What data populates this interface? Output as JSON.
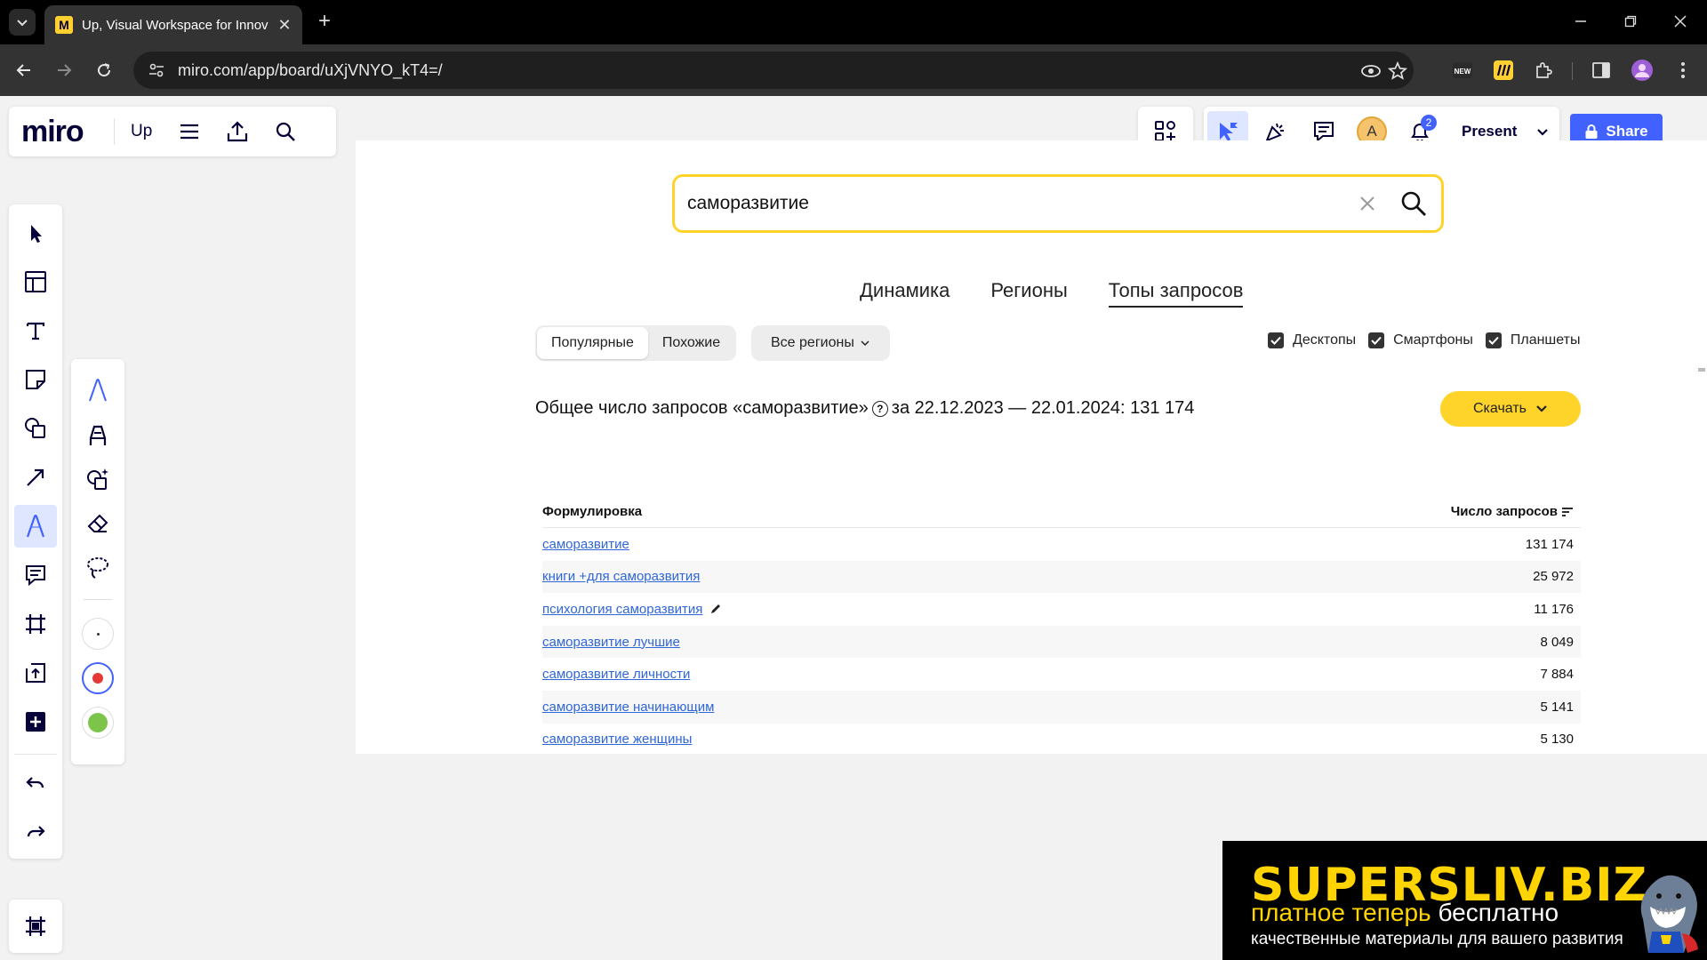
{
  "browser": {
    "tab_title": "Up, Visual Workspace for Innov",
    "url": "miro.com/app/board/uXjVNYO_kT4=/",
    "new_tab": "+",
    "close_tab": "✕"
  },
  "miro": {
    "logo": "miro",
    "board_name": "Up",
    "avatar_initial": "A",
    "notifications_count": "2",
    "present_label": "Present",
    "share_label": "Share",
    "accent": "#4262ff"
  },
  "wordstat": {
    "search_value": "саморазвитие",
    "tabs": [
      "Динамика",
      "Регионы",
      "Топы запросов"
    ],
    "segments": [
      "Популярные",
      "Похожие"
    ],
    "region": "Все регионы",
    "devices": [
      "Десктопы",
      "Смартфоны",
      "Планшеты"
    ],
    "total_text": "Общее число запросов «саморазвитие»",
    "total_period": "за 22.12.2023 — 22.01.2024: 131 174",
    "download_label": "Скачать",
    "table": {
      "col_phrase": "Формулировка",
      "col_count": "Число запросов",
      "rows": [
        {
          "phrase": "саморазвитие",
          "count": "131 174"
        },
        {
          "phrase": "книги +для саморазвития",
          "count": "25 972"
        },
        {
          "phrase": "психология саморазвития",
          "count": "11 176"
        },
        {
          "phrase": "саморазвитие лучшие",
          "count": "8 049"
        },
        {
          "phrase": "саморазвитие личности",
          "count": "7 884"
        },
        {
          "phrase": "саморазвитие начинающим",
          "count": "5 141"
        },
        {
          "phrase": "саморазвитие женщины",
          "count": "5 130"
        }
      ]
    },
    "accent_yellow": "#fed42b",
    "link_color": "#2f66d8"
  },
  "watermark": {
    "title": "SUPERSLIV.BIZ",
    "sub_yellow": "платное теперь",
    "sub_white": "бесплатно",
    "small": "качественные материалы для вашего развития"
  }
}
